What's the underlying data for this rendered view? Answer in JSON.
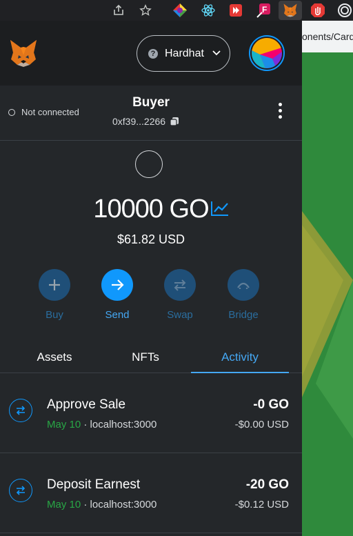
{
  "browser": {
    "extensions": [
      "share-icon",
      "star-icon",
      "color-wheel-icon",
      "react-icon",
      "redux-icon",
      "f-icon",
      "metamask-fox-icon",
      "stop-hand-icon",
      "record-icon"
    ]
  },
  "page": {
    "url_fragment": "onents/Card"
  },
  "wallet": {
    "network": "Hardhat",
    "connection_status": "Not connected",
    "account_name": "Buyer",
    "account_address": "0xf39...2266",
    "balance": "10000 GO",
    "fiat_balance": "$61.82 USD",
    "actions": [
      {
        "label": "Buy",
        "icon": "plus-icon"
      },
      {
        "label": "Send",
        "icon": "arrow-right-icon"
      },
      {
        "label": "Swap",
        "icon": "swap-icon"
      },
      {
        "label": "Bridge",
        "icon": "bridge-icon"
      }
    ],
    "tabs": [
      "Assets",
      "NFTs",
      "Activity"
    ],
    "active_tab": "Activity",
    "activity": [
      {
        "title": "Approve Sale",
        "date": "May 10",
        "origin": "localhost:3000",
        "amount": "-0 GO",
        "fiat": "-$0.00 USD"
      },
      {
        "title": "Deposit Earnest",
        "date": "May 10",
        "origin": "localhost:3000",
        "amount": "-20 GO",
        "fiat": "-$0.12 USD"
      }
    ]
  },
  "colors": {
    "accent": "#1098fc",
    "success": "#28a745",
    "background": "#24272a"
  }
}
